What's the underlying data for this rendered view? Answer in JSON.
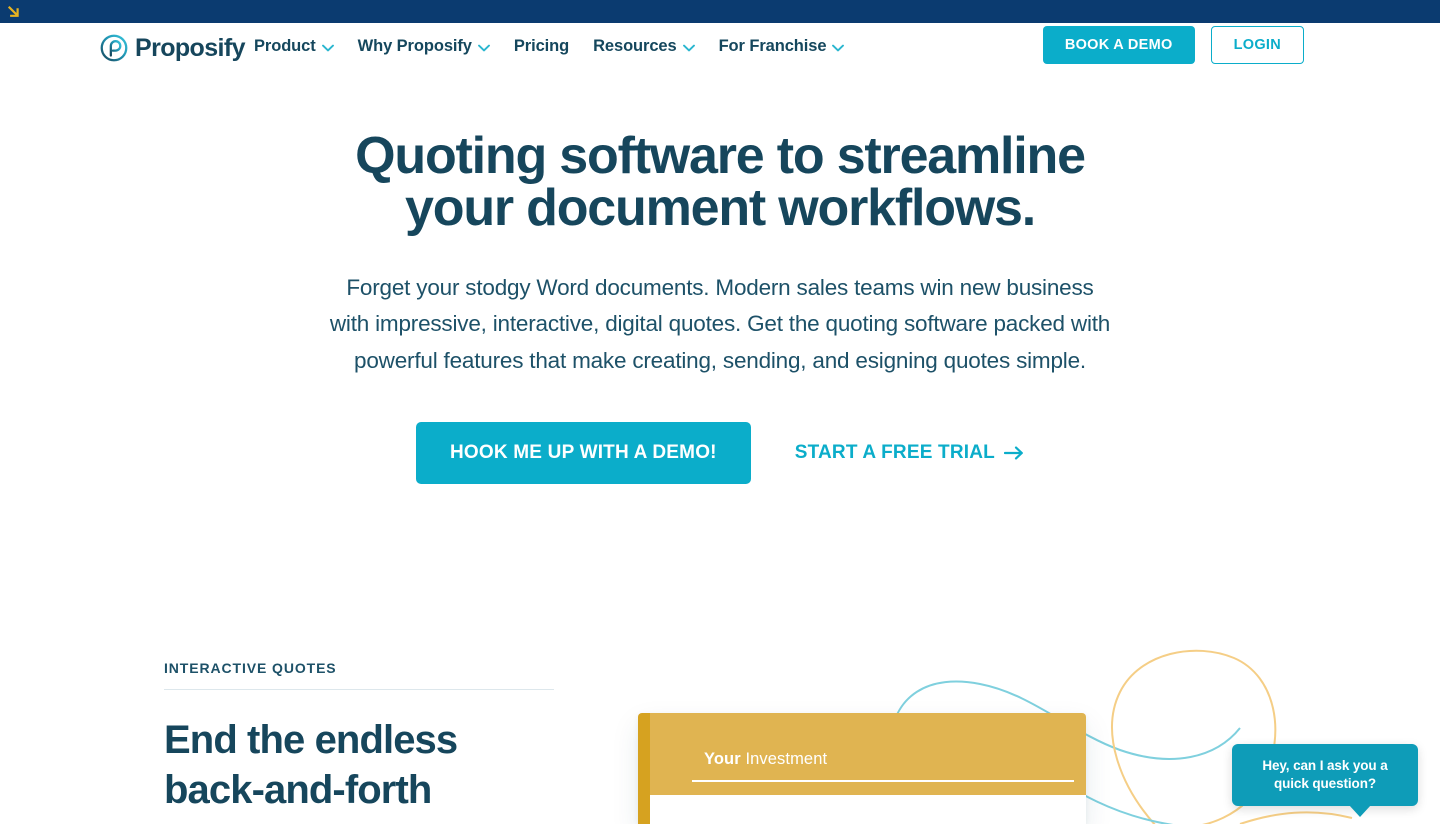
{
  "announcement_bar": {
    "icon": "arrow-down-right-icon",
    "bg_color": "#0b3b70",
    "arrow_color": "#e8b321"
  },
  "header": {
    "logo": {
      "name": "Proposify",
      "mark": "proposify-spiral-p-icon"
    },
    "nav": [
      {
        "label": "Product",
        "has_dropdown": true
      },
      {
        "label": "Why Proposify",
        "has_dropdown": true
      },
      {
        "label": "Pricing",
        "has_dropdown": false
      },
      {
        "label": "Resources",
        "has_dropdown": true
      },
      {
        "label": "For Franchise",
        "has_dropdown": true
      }
    ],
    "book_demo_label": "BOOK A DEMO",
    "login_label": "LOGIN"
  },
  "hero": {
    "title_line1": "Quoting software to streamline",
    "title_line2": "your document workflows.",
    "subtitle": "Forget your stodgy Word documents. Modern sales teams win new business with impressive, interactive, digital quotes. Get the quoting software packed with powerful features that make creating, sending, and esigning quotes simple.",
    "primary_cta": "HOOK ME UP WITH A DEMO!",
    "secondary_cta": "START A FREE TRIAL",
    "secondary_cta_icon": "arrow-right-icon"
  },
  "feature_section": {
    "eyebrow": "INTERACTIVE QUOTES",
    "title_line1": "End the endless",
    "title_line2": "back-and-forth"
  },
  "document_mockup": {
    "header_label_bold": "Your",
    "header_label_regular": " Investment",
    "spine_color": "#d6a220",
    "header_color": "#e0b451"
  },
  "chat_widget": {
    "message": "Hey, can I ask you a quick question?",
    "bg_color": "#0e9cb8"
  },
  "theme": {
    "brand_teal": "#0badca",
    "brand_navy": "#16465c",
    "top_bar_navy": "#0b3b70",
    "gold": "#e0b451",
    "text_body": "#1d5168"
  }
}
